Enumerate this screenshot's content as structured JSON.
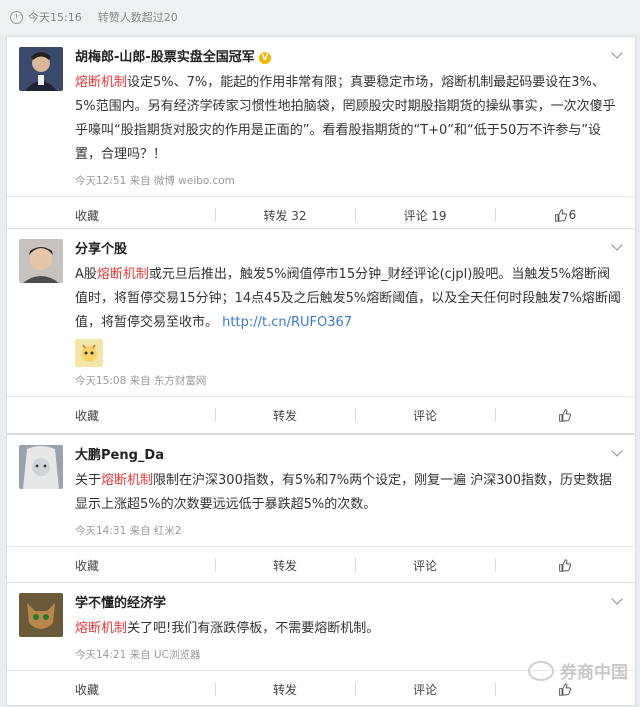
{
  "topbar": {
    "time": "今天15:16",
    "forward_info": "转赞人数超过20"
  },
  "posts": [
    {
      "author": "胡梅郎-山郎-股票实盘全国冠军",
      "text_kw": "熔断机制",
      "text_rest": "设定5%、7%，能起的作用非常有限；真要稳定市场，熔断机制最起码要设在3%、5%范围内。另有经济学砖家习惯性地拍脑袋，罔顾股灾时期股指期货的操纵事实，一次次傻乎乎嚎叫“股指期货对股灾的作用是正面的”。看看股指期货的“T+0”和“低于50万不许参与”设置，合理吗？！",
      "meta": "今天12:51 来自 微博 weibo.com",
      "actions": {
        "collect": "收藏",
        "repost": "转发 32",
        "comment": "评论 19",
        "like": "6"
      }
    },
    {
      "author": "分享个股",
      "text_pre": "A股",
      "text_kw": "熔断机制",
      "text_rest": "或元旦后推出，触发5%阀值停市15分钟_财经评论(cjpl)股吧。当触发5%熔断阀值时，将暂停交易15分钟；14点45及之后触发5%熔断阈值，以及全天任何时段触发7%熔断阈值，将暂停交易至收市。",
      "link": "http://t.cn/RUFO367",
      "meta": "今天15:08 来自 东方财富网",
      "actions": {
        "collect": "收藏",
        "repost": "转发",
        "comment": "评论",
        "like": ""
      }
    },
    {
      "author": "大鹏Peng_Da",
      "text_pre": "关于",
      "text_kw": "熔断机制",
      "text_rest": "限制在沪深300指数，有5%和7%两个设定，刚复一遍 沪深300指数，历史数据显示上涨超5%的次数要远远低于暴跌超5%的次数。",
      "meta": "今天14:31 来自 红米2",
      "actions": {
        "collect": "收藏",
        "repost": "转发",
        "comment": "评论",
        "like": ""
      }
    },
    {
      "author": "学不懂的经济学",
      "text_kw": "熔断机制",
      "text_rest": "关了吧!我们有涨跌停板，不需要熔断机制。",
      "meta": "今天14:21 来自 UC浏览器",
      "actions": {
        "collect": "收藏",
        "repost": "转发",
        "comment": "评论",
        "like": ""
      }
    }
  ],
  "watermark": "券商中国",
  "colors": {
    "keyword": "#e4393c",
    "link": "#3a7ac9",
    "verified": "#f5b400"
  }
}
